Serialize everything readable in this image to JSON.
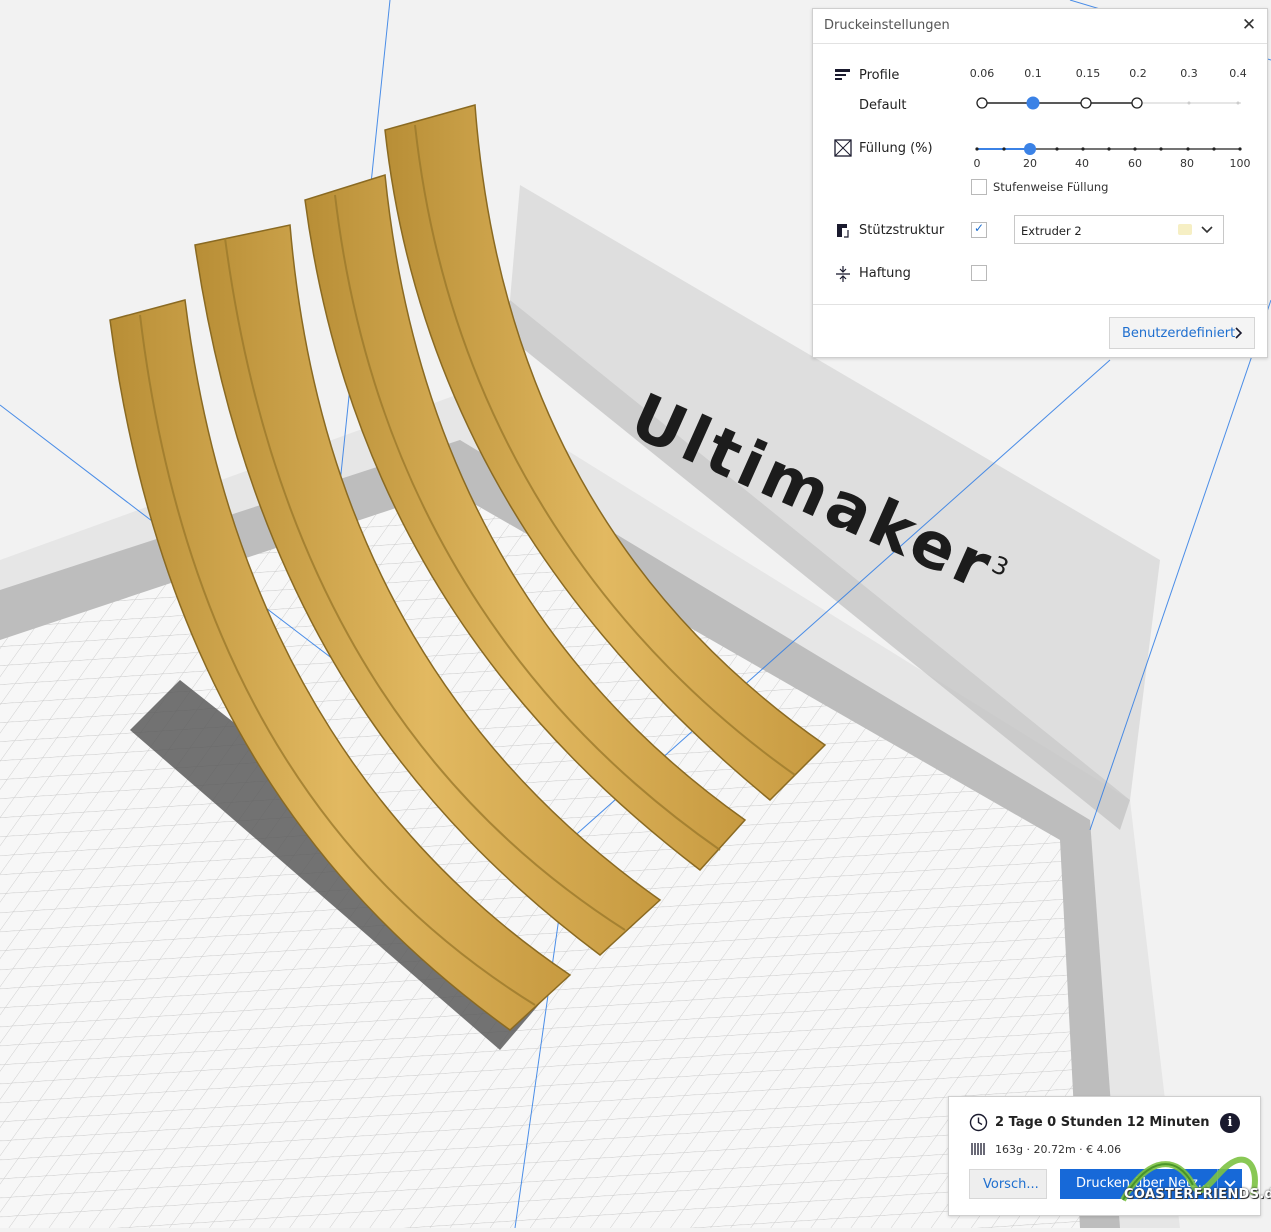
{
  "viewport": {
    "brand_name": "Ultimaker",
    "brand_suffix": "3"
  },
  "print_settings": {
    "title": "Druckeinstellungen",
    "close_label": "✕",
    "profile": {
      "label": "Profile",
      "sub_label": "Default",
      "layer_heights": [
        "0.06",
        "0.1",
        "0.15",
        "0.2",
        "0.3",
        "0.4"
      ],
      "selected": "0.1"
    },
    "infill": {
      "label": "Füllung (%)",
      "ticks": [
        "0",
        "20",
        "40",
        "60",
        "80",
        "100"
      ],
      "value": 20,
      "gradual_label": "Stufenweise Füllung",
      "gradual_checked": false
    },
    "support": {
      "label": "Stützstruktur",
      "checked": true,
      "extruder": "Extruder 2",
      "extruder_color": "#f6efc4"
    },
    "adhesion": {
      "label": "Haftung",
      "checked": false
    },
    "custom_button": "Benutzerdefiniert"
  },
  "estimate": {
    "time": "2 Tage 0 Stunden 12 Minuten",
    "material": "163g · 20.72m · € 4.06",
    "preview_button": "Vorsch...",
    "print_button": "Drucken über Netz...",
    "info_symbol": "i"
  },
  "watermark": {
    "text": "COASTERFRIENDS.de"
  },
  "colors": {
    "accent": "#1769d8",
    "model": "#d4a94a",
    "grid": "#cfcfcf"
  }
}
